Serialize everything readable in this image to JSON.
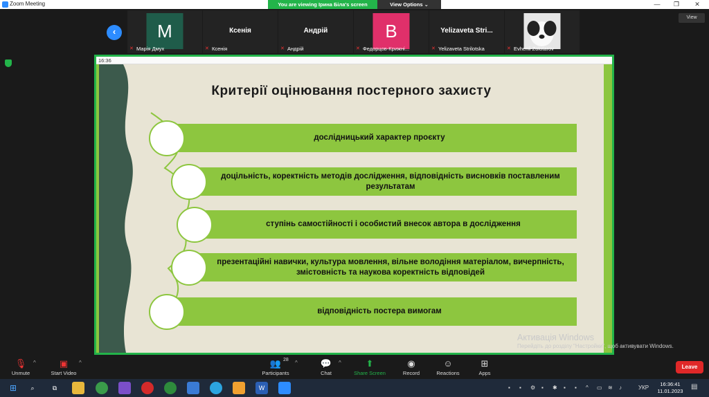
{
  "window": {
    "title": "Zoom Meeting",
    "banner_text": "You are viewing Ірина Біла's screen",
    "view_options": "View Options ⌄",
    "view_button": "View"
  },
  "participants": [
    {
      "avatar_letter": "M",
      "avatar_color": "#1f5c4a",
      "label": "Марія Дмух"
    },
    {
      "big_name": "Ксенія",
      "label": "Ксенія"
    },
    {
      "big_name": "Андрій",
      "label": "Андрій"
    },
    {
      "avatar_letter": "B",
      "avatar_color": "#e0306a",
      "label": "Федорцов-Крижні..."
    },
    {
      "big_name": "Yelizaveta Stri...",
      "label": "Yelizaveta Strilotska"
    },
    {
      "label": "Evhenii Zolotarov"
    }
  ],
  "shared_screen": {
    "top_time": "16:36"
  },
  "slide": {
    "title": "Критерії оцінювання постерного захисту",
    "items": [
      "дослідницький характер проєкту",
      "доцільність, коректність методів дослідження, відповідність висновків поставленим результатам",
      "ступінь самостійності і особистий внесок автора в дослідження",
      "презентаційні навички, культура мовлення, вільне володіння матеріалом, вичерпність, змістовність та наукова коректність відповідей",
      "відповідність постера вимогам"
    ],
    "colors": {
      "bar": "#8dc63f",
      "background": "#e8e4d4",
      "wave": "#3c5a4c"
    }
  },
  "watermark": {
    "heading": "Активація Windows",
    "text": "Перейдіть до розділу \"Настройки\", щоб активувати Windows."
  },
  "controls": {
    "unmute": "Unmute",
    "start_video": "Start Video",
    "participants": "Participants",
    "participants_count": "28",
    "chat": "Chat",
    "share_screen": "Share Screen",
    "record": "Record",
    "reactions": "Reactions",
    "apps": "Apps",
    "leave": "Leave"
  },
  "taskbar": {
    "language": "УКР",
    "time": "16:36:41",
    "date": "11.01.2023"
  }
}
